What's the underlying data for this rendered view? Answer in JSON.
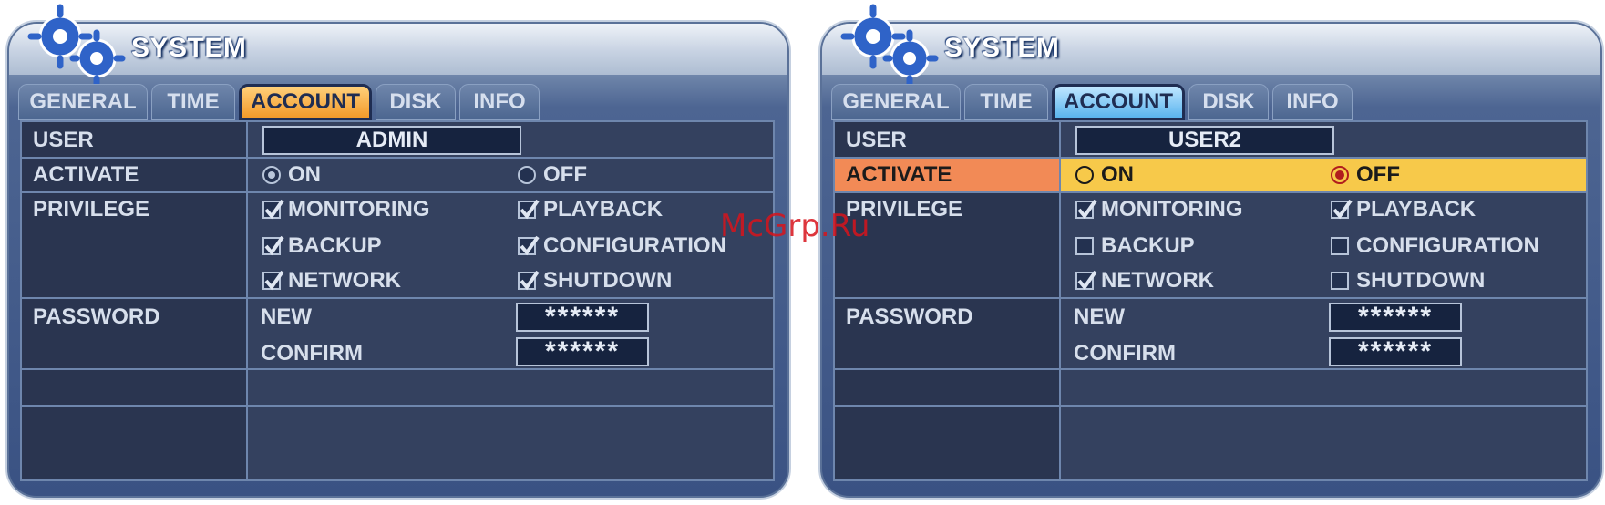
{
  "watermark": "McGrp.Ru",
  "panels": [
    {
      "title": "SYSTEM",
      "tabs": [
        "GENERAL",
        "TIME",
        "ACCOUNT",
        "DISK",
        "INFO"
      ],
      "active_tab": "ACCOUNT",
      "labels": {
        "user": "USER",
        "activate": "ACTIVATE",
        "privilege": "PRIVILEGE",
        "password": "PASSWORD"
      },
      "user_value": "ADMIN",
      "activate": {
        "on_label": "ON",
        "off_label": "OFF",
        "selected": "ON"
      },
      "privileges": [
        {
          "label": "MONITORING",
          "checked": true
        },
        {
          "label": "PLAYBACK",
          "checked": true
        },
        {
          "label": "BACKUP",
          "checked": true
        },
        {
          "label": "CONFIGURATION",
          "checked": true
        },
        {
          "label": "NETWORK",
          "checked": true
        },
        {
          "label": "SHUTDOWN",
          "checked": true
        }
      ],
      "password": {
        "new_label": "NEW",
        "confirm_label": "CONFIRM",
        "new_value": "******",
        "confirm_value": "******"
      }
    },
    {
      "title": "SYSTEM",
      "tabs": [
        "GENERAL",
        "TIME",
        "ACCOUNT",
        "DISK",
        "INFO"
      ],
      "active_tab": "ACCOUNT",
      "labels": {
        "user": "USER",
        "activate": "ACTIVATE",
        "privilege": "PRIVILEGE",
        "password": "PASSWORD"
      },
      "user_value": "USER2",
      "activate": {
        "on_label": "ON",
        "off_label": "OFF",
        "selected": "OFF"
      },
      "privileges": [
        {
          "label": "MONITORING",
          "checked": true
        },
        {
          "label": "PLAYBACK",
          "checked": true
        },
        {
          "label": "BACKUP",
          "checked": false
        },
        {
          "label": "CONFIGURATION",
          "checked": false
        },
        {
          "label": "NETWORK",
          "checked": true
        },
        {
          "label": "SHUTDOWN",
          "checked": false
        }
      ],
      "password": {
        "new_label": "NEW",
        "confirm_label": "CONFIRM",
        "new_value": "******",
        "confirm_value": "******"
      }
    }
  ],
  "colors": {
    "active_tab_left": "#f39a2a",
    "active_tab_right": "#5ab4ee",
    "highlight_label": "#f28a56",
    "highlight_row": "#f7c94a",
    "panel_bg": "#3a5283"
  }
}
